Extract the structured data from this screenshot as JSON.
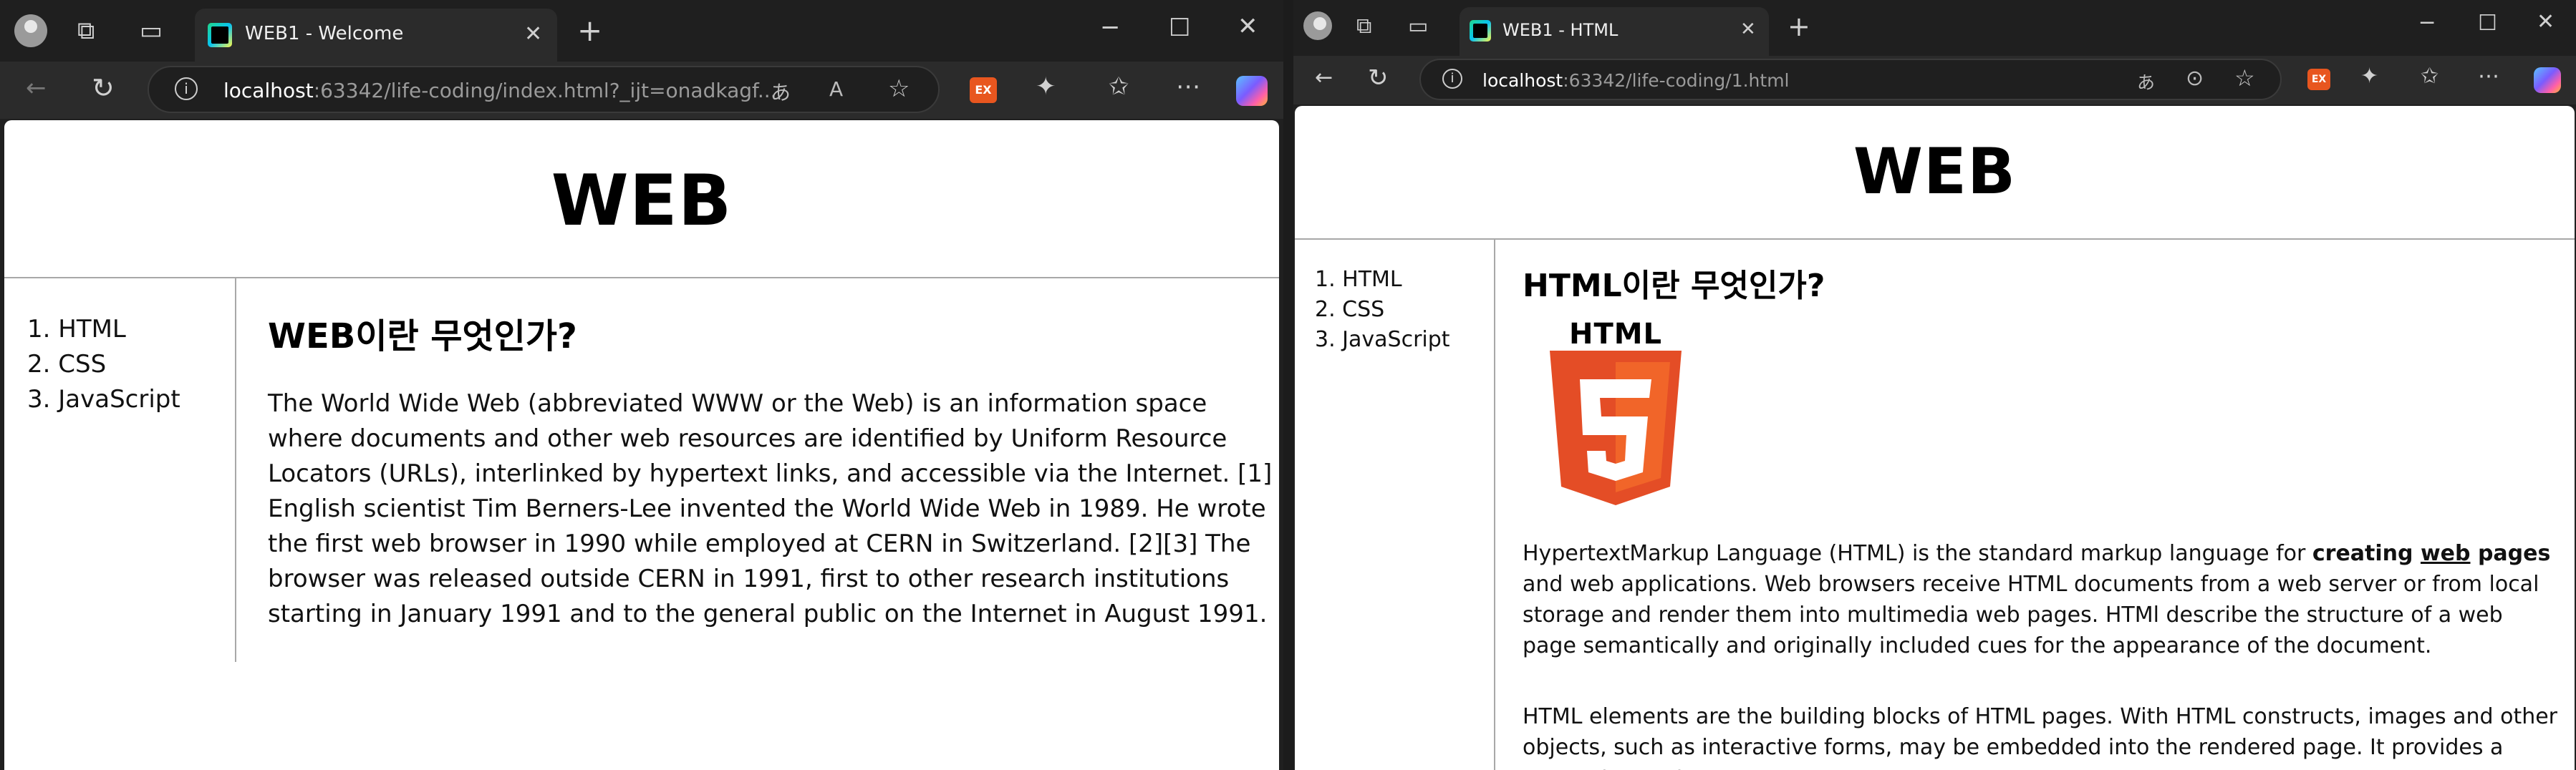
{
  "windows": [
    {
      "tab_title": "WEB1 - Welcome",
      "url_host": "localhost",
      "url_rest": ":63342/life-coding/index.html?_ijt=onadkagf...",
      "heading": "WEB",
      "nav": [
        "1. HTML",
        "2. CSS",
        "3. JavaScript"
      ],
      "article_title": "WEB이란 무엇인가?",
      "paragraphs": [
        "The World Wide Web (abbreviated WWW or the Web) is an information space where documents and other web resources are identified by Uniform Resource Locators (URLs), interlinked by hypertext links, and accessible via the Internet. [1] English scientist Tim Berners-Lee invented the World Wide Web in 1989. He wrote the first web browser in 1990 while employed at CERN in Switzerland. [2][3] The browser was released outside CERN in 1991, first to other research institutions starting in January 1991 and to the general public on the Internet in August 1991."
      ]
    },
    {
      "tab_title": "WEB1 - HTML",
      "url_host": "localhost",
      "url_rest": ":63342/life-coding/1.html",
      "heading": "WEB",
      "nav": [
        "1. HTML",
        "2. CSS",
        "3. JavaScript"
      ],
      "article_title": "HTML이란 무엇인가?",
      "logo_text": "HTML",
      "logo_number": "5",
      "p1_before": "HypertextMarkup Language (HTML) is the standard markup language for ",
      "p1_bold1": "creating ",
      "p1_bold_underline": "web",
      "p1_bold2": " pages",
      "p1_after": " and web applications. Web browsers receive HTML documents from a web server or from local storage and render them into multimedia web pages. HTMl describe the structure of a web page semantically and originally included cues for the appearance of the document.",
      "p2": "HTML elements are the building blocks of HTML pages. With HTML constructs, images and other objects, such as interactive forms, may be embedded into the rendered page. It provides a means to create"
    }
  ],
  "toolbar": {
    "extension_label": "EX",
    "icons": [
      "profile-icon",
      "workspaces-icon",
      "tab-actions-icon",
      "back-icon",
      "refresh-icon",
      "info-icon",
      "read-aloud-icon",
      "immersive-reader-icon",
      "favorite-star-icon",
      "extension-ex-icon",
      "extensions-puzzle-icon",
      "favorites-icon",
      "more-icon",
      "copilot-icon"
    ]
  },
  "colors": {
    "chrome_dark": "#1f1f1f",
    "toolbar": "#2b2b2b",
    "page_bg": "#ffffff",
    "divider": "#a8a8a8",
    "html5_orange": "#e44d26",
    "html5_light": "#f16529",
    "ex_orange": "#e8561f"
  }
}
